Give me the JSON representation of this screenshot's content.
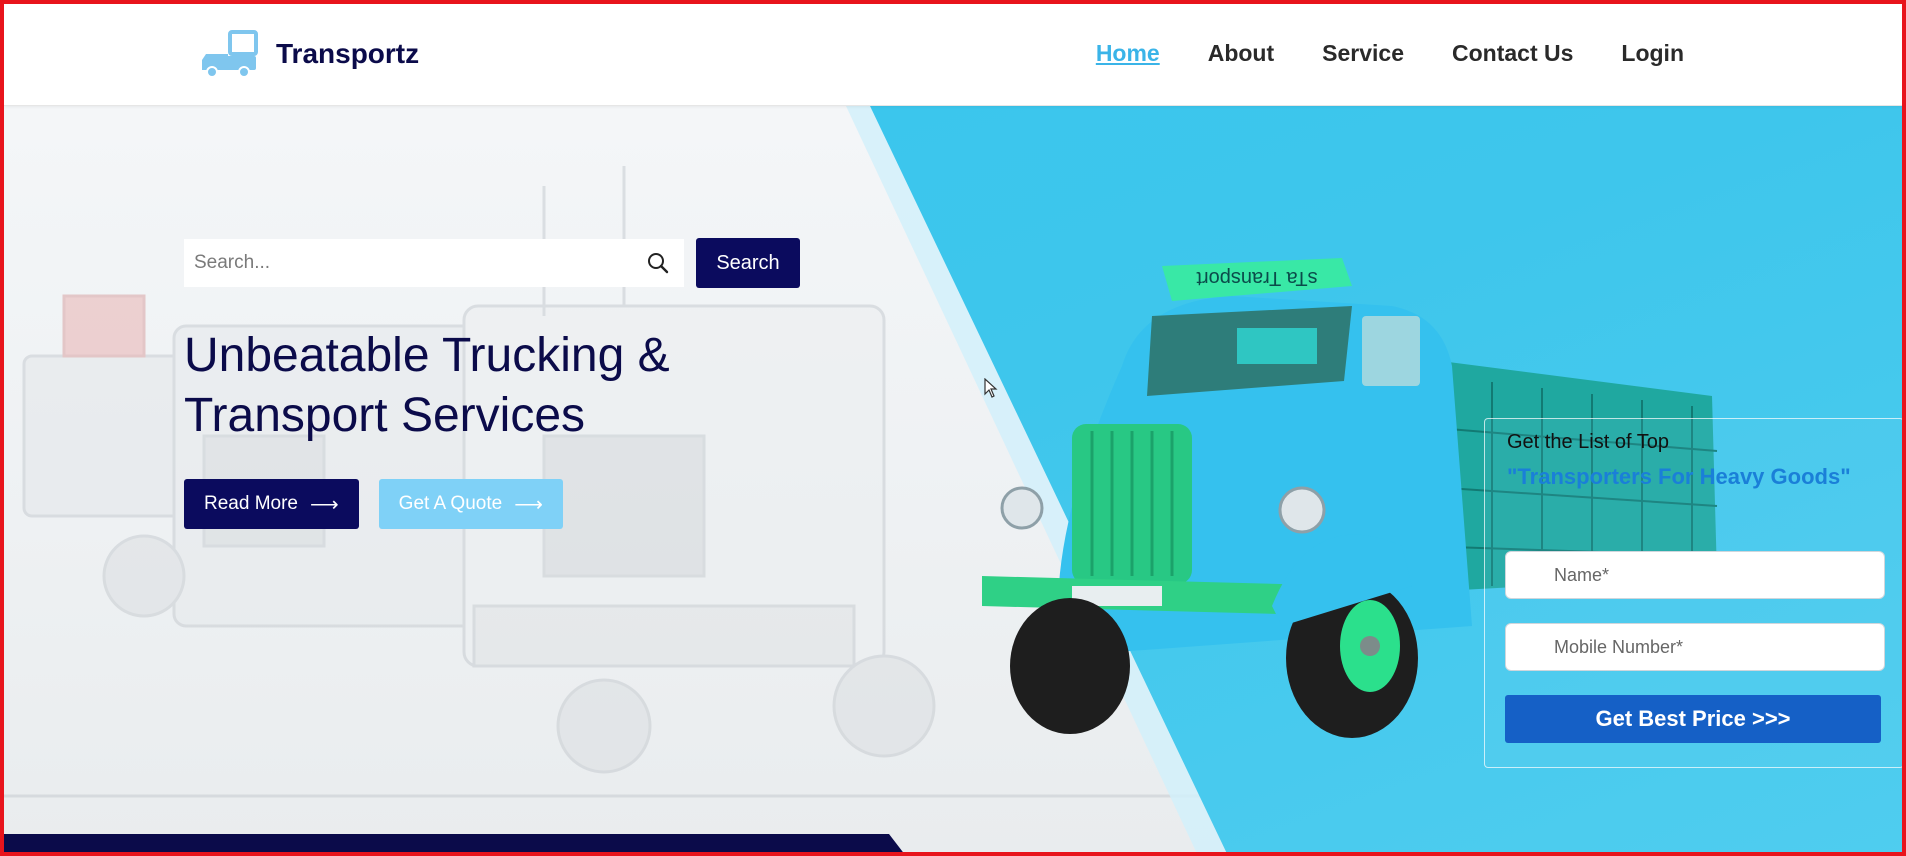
{
  "brand": {
    "name": "Transportz",
    "logo_icon": "truck-icon",
    "primary_color": "#0b0b5e",
    "accent_color": "#3ab4e8"
  },
  "nav": {
    "items": [
      {
        "label": "Home",
        "active": true
      },
      {
        "label": "About",
        "active": false
      },
      {
        "label": "Service",
        "active": false
      },
      {
        "label": "Contact Us",
        "active": false
      },
      {
        "label": "Login",
        "active": false
      }
    ]
  },
  "hero": {
    "search": {
      "placeholder": "Search...",
      "button_label": "Search",
      "icon": "search-icon"
    },
    "headline_line1": "Unbeatable Trucking &",
    "headline_line2": "Transport Services",
    "read_more_label": "Read More",
    "get_quote_label": "Get A Quote",
    "arrow_glyph": "⟶"
  },
  "truck_sign": "sTa Transport",
  "quote_form": {
    "heading": "Get the List of Top",
    "subheading": "\"Transporters For Heavy Goods\"",
    "name_placeholder": "Name*",
    "mobile_placeholder": "Mobile Number*",
    "submit_label": "Get Best Price >>>"
  }
}
